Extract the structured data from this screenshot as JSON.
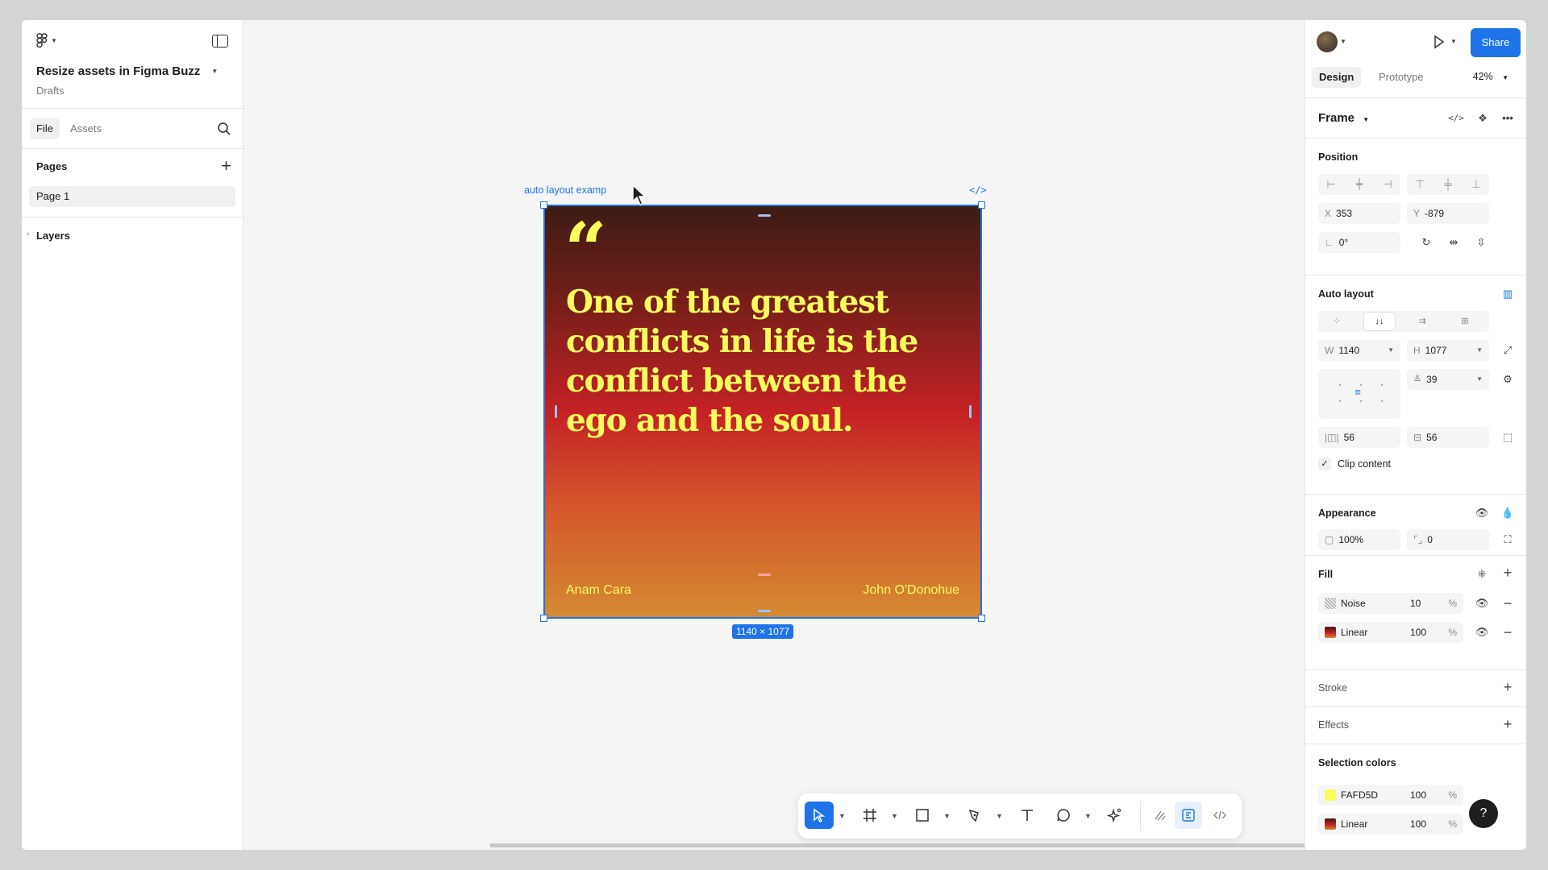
{
  "left_panel": {
    "file_name": "Resize assets in Figma Buzz",
    "location": "Drafts",
    "tabs": {
      "file": "File",
      "assets": "Assets"
    },
    "pages_label": "Pages",
    "pages": [
      "Page 1"
    ],
    "layers_label": "Layers"
  },
  "canvas": {
    "frame_label": "auto layout examp",
    "code_label": "</>",
    "quote_mark": "“",
    "quote_text": "One of the greatest conflicts in life is the conflict between the ego and the soul.",
    "footer_left": "Anam Cara",
    "footer_right": "John O'Donohue",
    "size_badge": "1140 × 1077",
    "text_color": "#FAFD5D"
  },
  "toolbar": {
    "tools": [
      "move-tool",
      "frame-tool",
      "rectangle-tool",
      "pen-tool",
      "text-tool",
      "comment-tool",
      "actions-tool",
      "draw-mode",
      "design-mode",
      "dev-mode"
    ]
  },
  "right_panel": {
    "share_label": "Share",
    "tabs": {
      "design": "Design",
      "prototype": "Prototype"
    },
    "zoom": "42%",
    "frame_label": "Frame",
    "position": {
      "title": "Position",
      "x_label": "X",
      "x": "353",
      "y_label": "Y",
      "y": "-879",
      "rotation": "0°"
    },
    "auto_layout": {
      "title": "Auto layout",
      "width_label": "W",
      "width": "1140",
      "height_label": "H",
      "height": "1077",
      "gap": "39",
      "padding_h": "56",
      "padding_v": "56",
      "clip_content_label": "Clip content",
      "clip_content": true
    },
    "appearance": {
      "title": "Appearance",
      "opacity": "100%",
      "radius": "0"
    },
    "fill": {
      "title": "Fill",
      "items": [
        {
          "name": "Noise",
          "value": "10",
          "unit": "%"
        },
        {
          "name": "Linear",
          "value": "100",
          "unit": "%"
        }
      ]
    },
    "stroke_title": "Stroke",
    "effects_title": "Effects",
    "selection_colors": {
      "title": "Selection colors",
      "items": [
        {
          "name": "FAFD5D",
          "value": "100",
          "unit": "%",
          "color": "#FAFD5D"
        },
        {
          "name": "Linear",
          "value": "100",
          "unit": "%",
          "color": "#B8201C"
        }
      ]
    },
    "help_label": "?"
  }
}
